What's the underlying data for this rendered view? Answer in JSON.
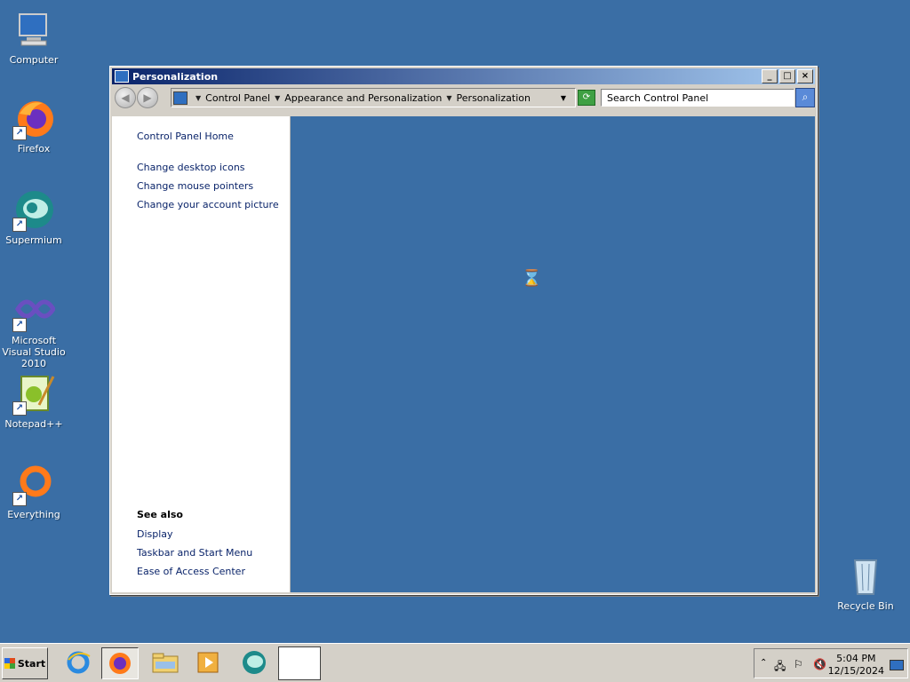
{
  "desktop": {
    "icons": [
      {
        "label": "Computer"
      },
      {
        "label": "Firefox"
      },
      {
        "label": "Supermium"
      },
      {
        "label": "Microsoft Visual Studio 2010"
      },
      {
        "label": "Notepad++"
      },
      {
        "label": "Everything"
      },
      {
        "label": "Recycle Bin"
      }
    ]
  },
  "window": {
    "title": "Personalization",
    "breadcrumb": [
      "Control Panel",
      "Appearance and Personalization",
      "Personalization"
    ],
    "search_placeholder": "Search Control Panel",
    "left_links": [
      "Control Panel Home",
      "Change desktop icons",
      "Change mouse pointers",
      "Change your account picture"
    ],
    "see_also_title": "See also",
    "see_also_links": [
      "Display",
      "Taskbar and Start Menu",
      "Ease of Access Center"
    ]
  },
  "taskbar": {
    "start_label": "Start",
    "clock_time": "5:04 PM",
    "clock_date": "12/15/2024"
  },
  "colors": {
    "desktop": "#3a6ea5",
    "title_gradient_start": "#0a246a",
    "link": "#0a246a"
  }
}
